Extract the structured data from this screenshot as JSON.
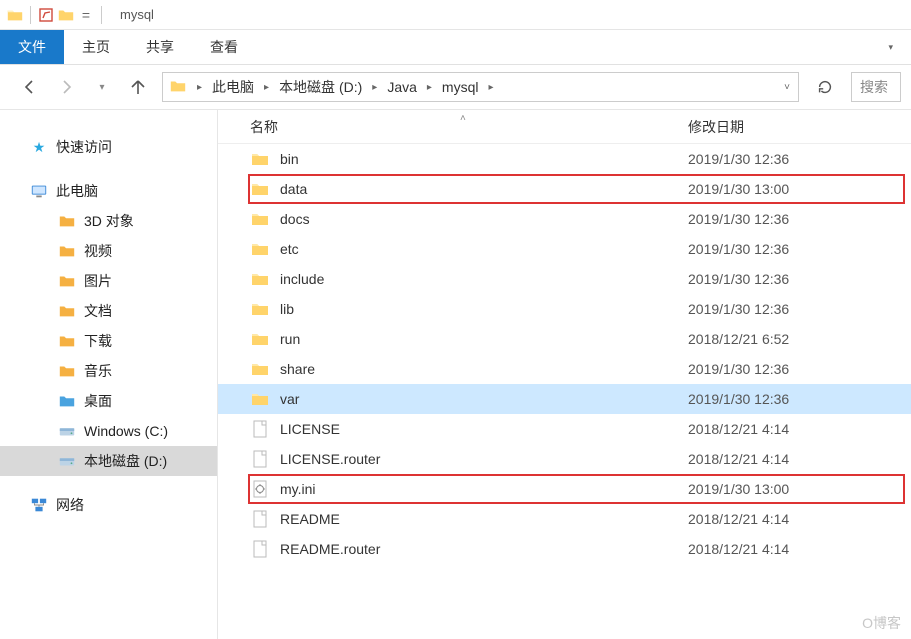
{
  "window": {
    "title": "mysql"
  },
  "ribbon": {
    "file": "文件",
    "tabs": [
      "主页",
      "共享",
      "查看"
    ]
  },
  "breadcrumbs": [
    "此电脑",
    "本地磁盘 (D:)",
    "Java",
    "mysql"
  ],
  "search": {
    "placeholder": "搜索"
  },
  "navpane": {
    "quickaccess": "快速访问",
    "thispc": "此电脑",
    "items": [
      {
        "label": "3D 对象",
        "kind": "3d"
      },
      {
        "label": "视频",
        "kind": "video"
      },
      {
        "label": "图片",
        "kind": "pictures"
      },
      {
        "label": "文档",
        "kind": "docs"
      },
      {
        "label": "下载",
        "kind": "downloads"
      },
      {
        "label": "音乐",
        "kind": "music"
      },
      {
        "label": "桌面",
        "kind": "desktop"
      },
      {
        "label": "Windows (C:)",
        "kind": "drive-c"
      },
      {
        "label": "本地磁盘 (D:)",
        "kind": "drive-d",
        "selected": true
      }
    ],
    "network": "网络"
  },
  "columns": {
    "name": "名称",
    "date": "修改日期"
  },
  "files": [
    {
      "name": "bin",
      "date": "2019/1/30 12:36",
      "type": "folder"
    },
    {
      "name": "data",
      "date": "2019/1/30 13:00",
      "type": "folder",
      "highlight": true
    },
    {
      "name": "docs",
      "date": "2019/1/30 12:36",
      "type": "folder"
    },
    {
      "name": "etc",
      "date": "2019/1/30 12:36",
      "type": "folder"
    },
    {
      "name": "include",
      "date": "2019/1/30 12:36",
      "type": "folder"
    },
    {
      "name": "lib",
      "date": "2019/1/30 12:36",
      "type": "folder"
    },
    {
      "name": "run",
      "date": "2018/12/21 6:52",
      "type": "folder"
    },
    {
      "name": "share",
      "date": "2019/1/30 12:36",
      "type": "folder"
    },
    {
      "name": "var",
      "date": "2019/1/30 12:36",
      "type": "folder",
      "selected": true
    },
    {
      "name": "LICENSE",
      "date": "2018/12/21 4:14",
      "type": "file"
    },
    {
      "name": "LICENSE.router",
      "date": "2018/12/21 4:14",
      "type": "file"
    },
    {
      "name": "my.ini",
      "date": "2019/1/30 13:00",
      "type": "ini",
      "highlight": true
    },
    {
      "name": "README",
      "date": "2018/12/21 4:14",
      "type": "file"
    },
    {
      "name": "README.router",
      "date": "2018/12/21 4:14",
      "type": "file"
    }
  ],
  "watermark": "O博客"
}
